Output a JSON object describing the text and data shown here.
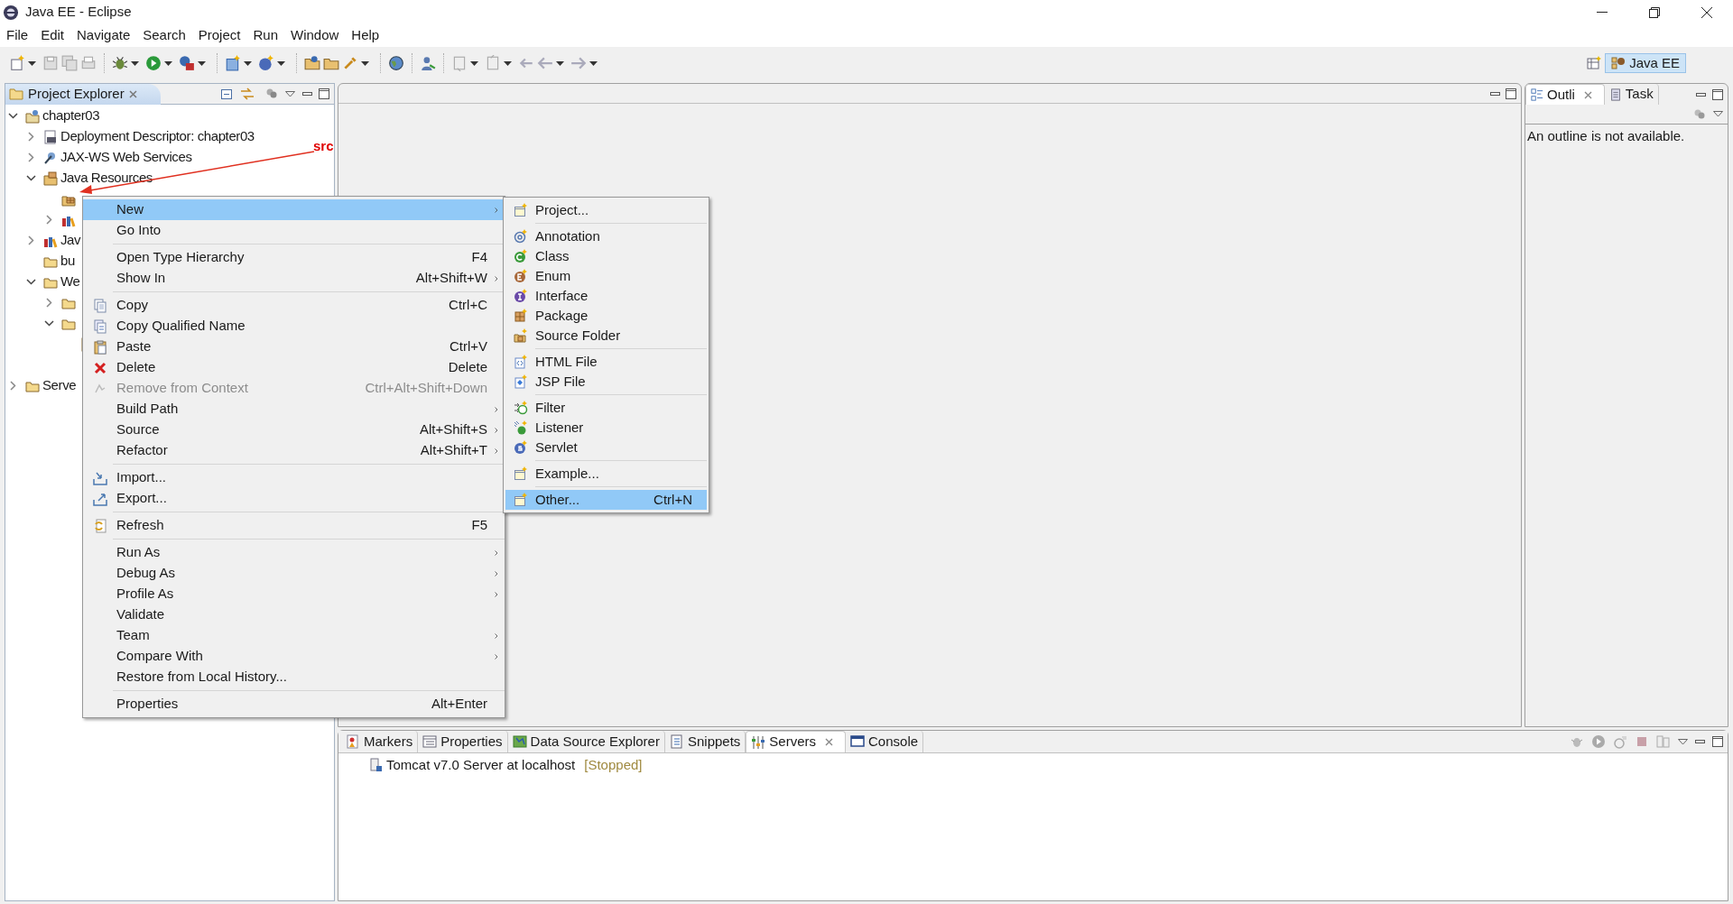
{
  "window": {
    "title": "Java EE - Eclipse"
  },
  "menu_bar": [
    "File",
    "Edit",
    "Navigate",
    "Search",
    "Project",
    "Run",
    "Window",
    "Help"
  ],
  "perspective": {
    "label": "Java EE",
    "selected": true
  },
  "project_explorer": {
    "title": "Project Explorer",
    "tree": [
      {
        "label": "chapter03",
        "kind": "project",
        "expanded": true,
        "children": [
          {
            "label": "Deployment Descriptor: chapter03",
            "kind": "descriptor",
            "expanded": false
          },
          {
            "label": "JAX-WS Web Services",
            "kind": "webservices",
            "expanded": false
          },
          {
            "label": "Java Resources",
            "kind": "resources",
            "expanded": true,
            "children": [
              {
                "kind": "source-folder"
              },
              {
                "kind": "library",
                "expanded": false
              }
            ]
          },
          {
            "label": "Jav",
            "kind": "library",
            "expanded": false
          },
          {
            "label": "bu",
            "kind": "folder"
          },
          {
            "label": "We",
            "kind": "folder",
            "expanded": true,
            "children": [
              {
                "kind": "folder",
                "expanded": false
              },
              {
                "kind": "folder",
                "expanded": true,
                "children": [
                  {
                    "kind": "file"
                  }
                ]
              }
            ]
          }
        ]
      },
      {
        "label": "Serve",
        "kind": "folder",
        "expanded": false
      }
    ]
  },
  "annotation": {
    "label": "src"
  },
  "context_menu": {
    "items": [
      {
        "kind": "item",
        "label": "New",
        "submenu": true,
        "selected": true,
        "disabled": false
      },
      {
        "kind": "item",
        "label": "Go Into",
        "submenu": false,
        "selected": false,
        "disabled": false
      },
      {
        "kind": "separator"
      },
      {
        "kind": "item",
        "label": "Open Type Hierarchy",
        "shortcut": "F4",
        "submenu": false,
        "selected": false,
        "disabled": false
      },
      {
        "kind": "item",
        "label": "Show In",
        "shortcut": "Alt+Shift+W",
        "submenu": true,
        "selected": false,
        "disabled": false
      },
      {
        "kind": "separator"
      },
      {
        "kind": "item",
        "label": "Copy",
        "shortcut": "Ctrl+C",
        "submenu": false,
        "selected": false,
        "disabled": false
      },
      {
        "kind": "item",
        "label": "Copy Qualified Name",
        "submenu": false,
        "selected": false,
        "disabled": false
      },
      {
        "kind": "item",
        "label": "Paste",
        "shortcut": "Ctrl+V",
        "submenu": false,
        "selected": false,
        "disabled": false
      },
      {
        "kind": "item",
        "label": "Delete",
        "shortcut": "Delete",
        "submenu": false,
        "selected": false,
        "disabled": false
      },
      {
        "kind": "item",
        "label": "Remove from Context",
        "shortcut": "Ctrl+Alt+Shift+Down",
        "submenu": false,
        "selected": false,
        "disabled": true
      },
      {
        "kind": "item",
        "label": "Build Path",
        "submenu": true,
        "selected": false,
        "disabled": false
      },
      {
        "kind": "item",
        "label": "Source",
        "shortcut": "Alt+Shift+S",
        "submenu": true,
        "selected": false,
        "disabled": false
      },
      {
        "kind": "item",
        "label": "Refactor",
        "shortcut": "Alt+Shift+T",
        "submenu": true,
        "selected": false,
        "disabled": false
      },
      {
        "kind": "separator"
      },
      {
        "kind": "item",
        "label": "Import...",
        "submenu": false,
        "selected": false,
        "disabled": false
      },
      {
        "kind": "item",
        "label": "Export...",
        "submenu": false,
        "selected": false,
        "disabled": false
      },
      {
        "kind": "separator"
      },
      {
        "kind": "item",
        "label": "Refresh",
        "shortcut": "F5",
        "submenu": false,
        "selected": false,
        "disabled": false
      },
      {
        "kind": "separator"
      },
      {
        "kind": "item",
        "label": "Run As",
        "submenu": true,
        "selected": false,
        "disabled": false
      },
      {
        "kind": "item",
        "label": "Debug As",
        "submenu": true,
        "selected": false,
        "disabled": false
      },
      {
        "kind": "item",
        "label": "Profile As",
        "submenu": true,
        "selected": false,
        "disabled": false
      },
      {
        "kind": "item",
        "label": "Validate",
        "submenu": false,
        "selected": false,
        "disabled": false
      },
      {
        "kind": "item",
        "label": "Team",
        "submenu": true,
        "selected": false,
        "disabled": false
      },
      {
        "kind": "item",
        "label": "Compare With",
        "submenu": true,
        "selected": false,
        "disabled": false
      },
      {
        "kind": "item",
        "label": "Restore from Local History...",
        "submenu": false,
        "selected": false,
        "disabled": false
      },
      {
        "kind": "separator"
      },
      {
        "kind": "item",
        "label": "Properties",
        "shortcut": "Alt+Enter",
        "submenu": false,
        "selected": false,
        "disabled": false
      }
    ]
  },
  "new_submenu": {
    "items": [
      {
        "kind": "item",
        "label": "Project...",
        "selected": false
      },
      {
        "kind": "separator"
      },
      {
        "kind": "item",
        "label": "Annotation",
        "selected": false
      },
      {
        "kind": "item",
        "label": "Class",
        "selected": false
      },
      {
        "kind": "item",
        "label": "Enum",
        "selected": false
      },
      {
        "kind": "item",
        "label": "Interface",
        "selected": false
      },
      {
        "kind": "item",
        "label": "Package",
        "selected": false
      },
      {
        "kind": "item",
        "label": "Source Folder",
        "selected": false
      },
      {
        "kind": "separator"
      },
      {
        "kind": "item",
        "label": "HTML File",
        "selected": false
      },
      {
        "kind": "item",
        "label": "JSP File",
        "selected": false
      },
      {
        "kind": "separator"
      },
      {
        "kind": "item",
        "label": "Filter",
        "selected": false
      },
      {
        "kind": "item",
        "label": "Listener",
        "selected": false
      },
      {
        "kind": "item",
        "label": "Servlet",
        "selected": false
      },
      {
        "kind": "separator"
      },
      {
        "kind": "item",
        "label": "Example...",
        "selected": false
      },
      {
        "kind": "separator"
      },
      {
        "kind": "item",
        "label": "Other...",
        "shortcut": "Ctrl+N",
        "selected": true
      }
    ]
  },
  "outline": {
    "tabs": [
      {
        "label": "Outli",
        "selected": true,
        "closable": true
      },
      {
        "label": "Task",
        "selected": false,
        "closable": false
      }
    ],
    "message": "An outline is not available."
  },
  "bottom_panel": {
    "tabs": [
      {
        "label": "Markers",
        "selected": false,
        "closable": false
      },
      {
        "label": "Properties",
        "selected": false,
        "closable": false
      },
      {
        "label": "Data Source Explorer",
        "selected": false,
        "closable": false
      },
      {
        "label": "Snippets",
        "selected": false,
        "closable": false
      },
      {
        "label": "Servers",
        "selected": true,
        "closable": true
      },
      {
        "label": "Console",
        "selected": false,
        "closable": false
      }
    ],
    "servers": [
      {
        "name": "Tomcat v7.0 Server at localhost",
        "status": "[Stopped]"
      }
    ]
  }
}
